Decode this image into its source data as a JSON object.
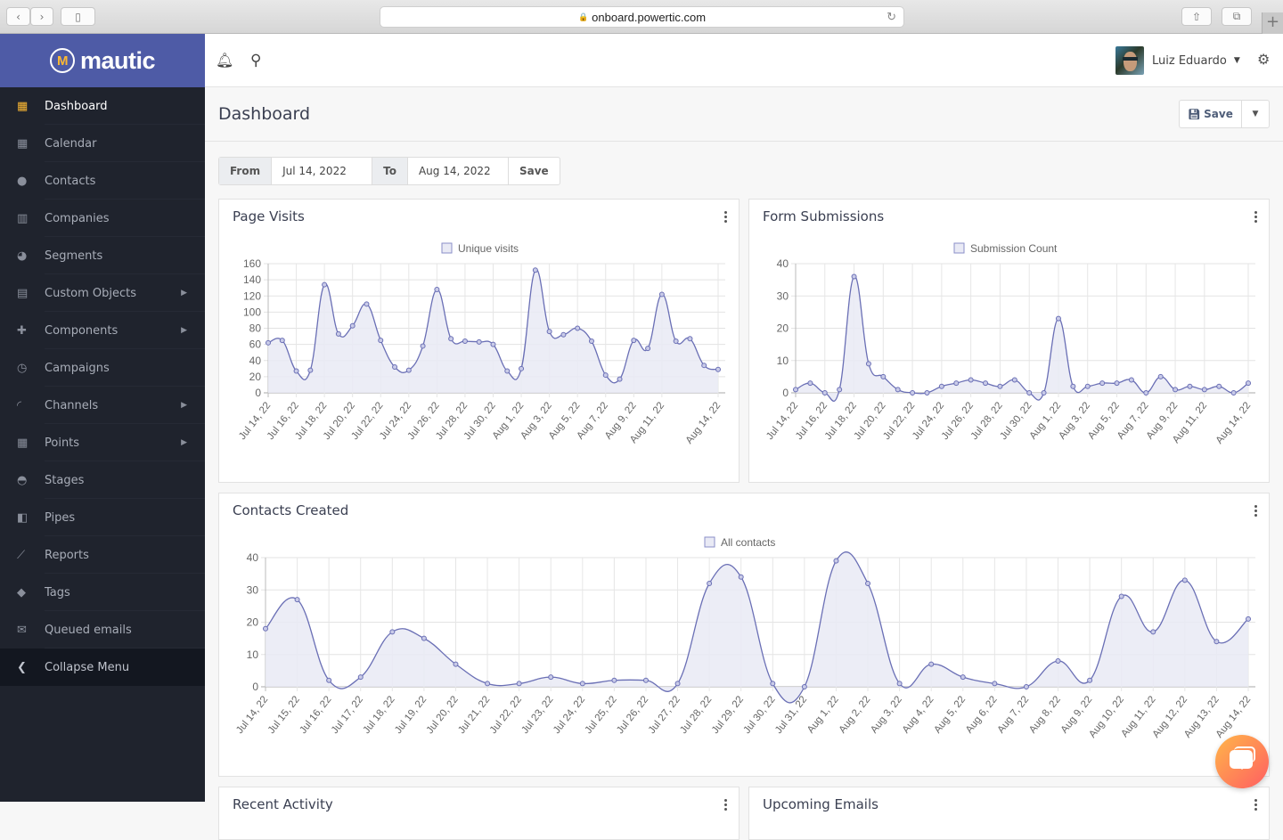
{
  "browser": {
    "url": "onboard.powertic.com"
  },
  "brand": {
    "name": "mautic",
    "logo_letter": "M"
  },
  "sidebar": {
    "items": [
      {
        "label": "Dashboard",
        "icon": "grid-icon",
        "glyph": "▦",
        "active": true,
        "submenu": false
      },
      {
        "label": "Calendar",
        "icon": "calendar-icon",
        "glyph": "▦",
        "active": false,
        "submenu": false
      },
      {
        "label": "Contacts",
        "icon": "user-icon",
        "glyph": "●",
        "active": false,
        "submenu": false
      },
      {
        "label": "Companies",
        "icon": "building-icon",
        "glyph": "▥",
        "active": false,
        "submenu": false
      },
      {
        "label": "Segments",
        "icon": "pie-chart-icon",
        "glyph": "◕",
        "active": false,
        "submenu": false
      },
      {
        "label": "Custom Objects",
        "icon": "list-alt-icon",
        "glyph": "▤",
        "active": false,
        "submenu": true
      },
      {
        "label": "Components",
        "icon": "puzzle-icon",
        "glyph": "✚",
        "active": false,
        "submenu": true
      },
      {
        "label": "Campaigns",
        "icon": "clock-icon",
        "glyph": "◷",
        "active": false,
        "submenu": false
      },
      {
        "label": "Channels",
        "icon": "rss-icon",
        "glyph": "◜",
        "active": false,
        "submenu": true
      },
      {
        "label": "Points",
        "icon": "calculator-icon",
        "glyph": "▦",
        "active": false,
        "submenu": true
      },
      {
        "label": "Stages",
        "icon": "tachometer-icon",
        "glyph": "◓",
        "active": false,
        "submenu": false
      },
      {
        "label": "Pipes",
        "icon": "trello-icon",
        "glyph": "◧",
        "active": false,
        "submenu": false
      },
      {
        "label": "Reports",
        "icon": "line-chart-icon",
        "glyph": "⟋",
        "active": false,
        "submenu": false
      },
      {
        "label": "Tags",
        "icon": "tag-icon",
        "glyph": "◆",
        "active": false,
        "submenu": false
      },
      {
        "label": "Queued emails",
        "icon": "envelope-icon",
        "glyph": "✉",
        "active": false,
        "submenu": false
      }
    ],
    "collapse_label": "Collapse Menu"
  },
  "topbar": {
    "user_name": "Luiz Eduardo"
  },
  "page": {
    "title": "Dashboard",
    "save_label": "Save"
  },
  "date_filter": {
    "from_label": "From",
    "from_value": "Jul 14, 2022",
    "to_label": "To",
    "to_value": "Aug 14, 2022",
    "save_label": "Save"
  },
  "widgets": {
    "page_visits_title": "Page Visits",
    "form_submissions_title": "Form Submissions",
    "contacts_created_title": "Contacts Created",
    "recent_activity_title": "Recent Activity",
    "upcoming_emails_title": "Upcoming Emails"
  },
  "chart_data": [
    {
      "id": "page-visits",
      "type": "line",
      "title": "Page Visits",
      "legend": "Unique visits",
      "legend_position": "top",
      "ylim": [
        0,
        160
      ],
      "yticks": [
        0,
        20,
        40,
        60,
        80,
        100,
        120,
        140,
        160
      ],
      "tick_labels": [
        "Jul 14, 22",
        "Jul 16, 22",
        "Jul 18, 22",
        "Jul 20, 22",
        "Jul 22, 22",
        "Jul 24, 22",
        "Jul 26, 22",
        "Jul 28, 22",
        "Jul 30, 22",
        "Aug 1, 22",
        "Aug 3, 22",
        "Aug 5, 22",
        "Aug 7, 22",
        "Aug 9, 22",
        "Aug 11, 22",
        "Aug 14, 22"
      ],
      "x": [
        "Jul 14",
        "Jul 15",
        "Jul 16",
        "Jul 17",
        "Jul 18",
        "Jul 19",
        "Jul 20",
        "Jul 21",
        "Jul 22",
        "Jul 23",
        "Jul 24",
        "Jul 25",
        "Jul 26",
        "Jul 27",
        "Jul 28",
        "Jul 29",
        "Jul 30",
        "Jul 31",
        "Aug 1",
        "Aug 2",
        "Aug 3",
        "Aug 4",
        "Aug 5",
        "Aug 6",
        "Aug 7",
        "Aug 8",
        "Aug 9",
        "Aug 10",
        "Aug 11",
        "Aug 12",
        "Aug 13",
        "Aug 14"
      ],
      "values": [
        62,
        65,
        27,
        28,
        134,
        73,
        83,
        110,
        65,
        32,
        28,
        58,
        128,
        67,
        64,
        63,
        60,
        27,
        30,
        152,
        76,
        72,
        80,
        64,
        22,
        17,
        65,
        55,
        122,
        64,
        67,
        34,
        29
      ],
      "grid": true
    },
    {
      "id": "form-submissions",
      "type": "line",
      "title": "Form Submissions",
      "legend": "Submission Count",
      "legend_position": "top",
      "ylim": [
        0,
        40
      ],
      "yticks": [
        0,
        10,
        20,
        30,
        40
      ],
      "tick_labels": [
        "Jul 14, 22",
        "Jul 16, 22",
        "Jul 18, 22",
        "Jul 20, 22",
        "Jul 22, 22",
        "Jul 24, 22",
        "Jul 26, 22",
        "Jul 28, 22",
        "Jul 30, 22",
        "Aug 1, 22",
        "Aug 3, 22",
        "Aug 5, 22",
        "Aug 7, 22",
        "Aug 9, 22",
        "Aug 11, 22",
        "Aug 14, 22"
      ],
      "values": [
        1,
        3,
        0,
        1,
        36,
        9,
        5,
        1,
        0,
        0,
        2,
        3,
        4,
        3,
        2,
        4,
        0,
        0,
        23,
        2,
        2,
        3,
        3,
        4,
        0,
        5,
        1,
        2,
        1,
        2,
        0,
        3
      ],
      "grid": true
    },
    {
      "id": "contacts-created",
      "type": "line",
      "title": "Contacts Created",
      "legend": "All contacts",
      "legend_position": "top",
      "ylim": [
        0,
        40
      ],
      "yticks": [
        0,
        10,
        20,
        30,
        40
      ],
      "tick_labels": [
        "Jul 14, 22",
        "Jul 15, 22",
        "Jul 16, 22",
        "Jul 17, 22",
        "Jul 18, 22",
        "Jul 19, 22",
        "Jul 20, 22",
        "Jul 21, 22",
        "Jul 22, 22",
        "Jul 23, 22",
        "Jul 24, 22",
        "Jul 25, 22",
        "Jul 26, 22",
        "Jul 27, 22",
        "Jul 28, 22",
        "Jul 29, 22",
        "Jul 30, 22",
        "Jul 31, 22",
        "Aug 1, 22",
        "Aug 2, 22",
        "Aug 3, 22",
        "Aug 4, 22",
        "Aug 5, 22",
        "Aug 6, 22",
        "Aug 7, 22",
        "Aug 8, 22",
        "Aug 9, 22",
        "Aug 10, 22",
        "Aug 11, 22",
        "Aug 12, 22",
        "Aug 13, 22",
        "Aug 14, 22"
      ],
      "values": [
        18,
        27,
        2,
        3,
        17,
        15,
        7,
        1,
        1,
        3,
        1,
        2,
        2,
        1,
        32,
        34,
        1,
        0,
        39,
        32,
        1,
        7,
        3,
        1,
        0,
        8,
        2,
        28,
        17,
        33,
        14,
        21
      ],
      "grid": true
    }
  ],
  "colors": {
    "accent": "#4e5ba6",
    "sidebar_bg": "#1f232d",
    "active_icon": "#fdb933",
    "series_line": "#6a6fb5",
    "series_fill": "#e9eaf5"
  }
}
